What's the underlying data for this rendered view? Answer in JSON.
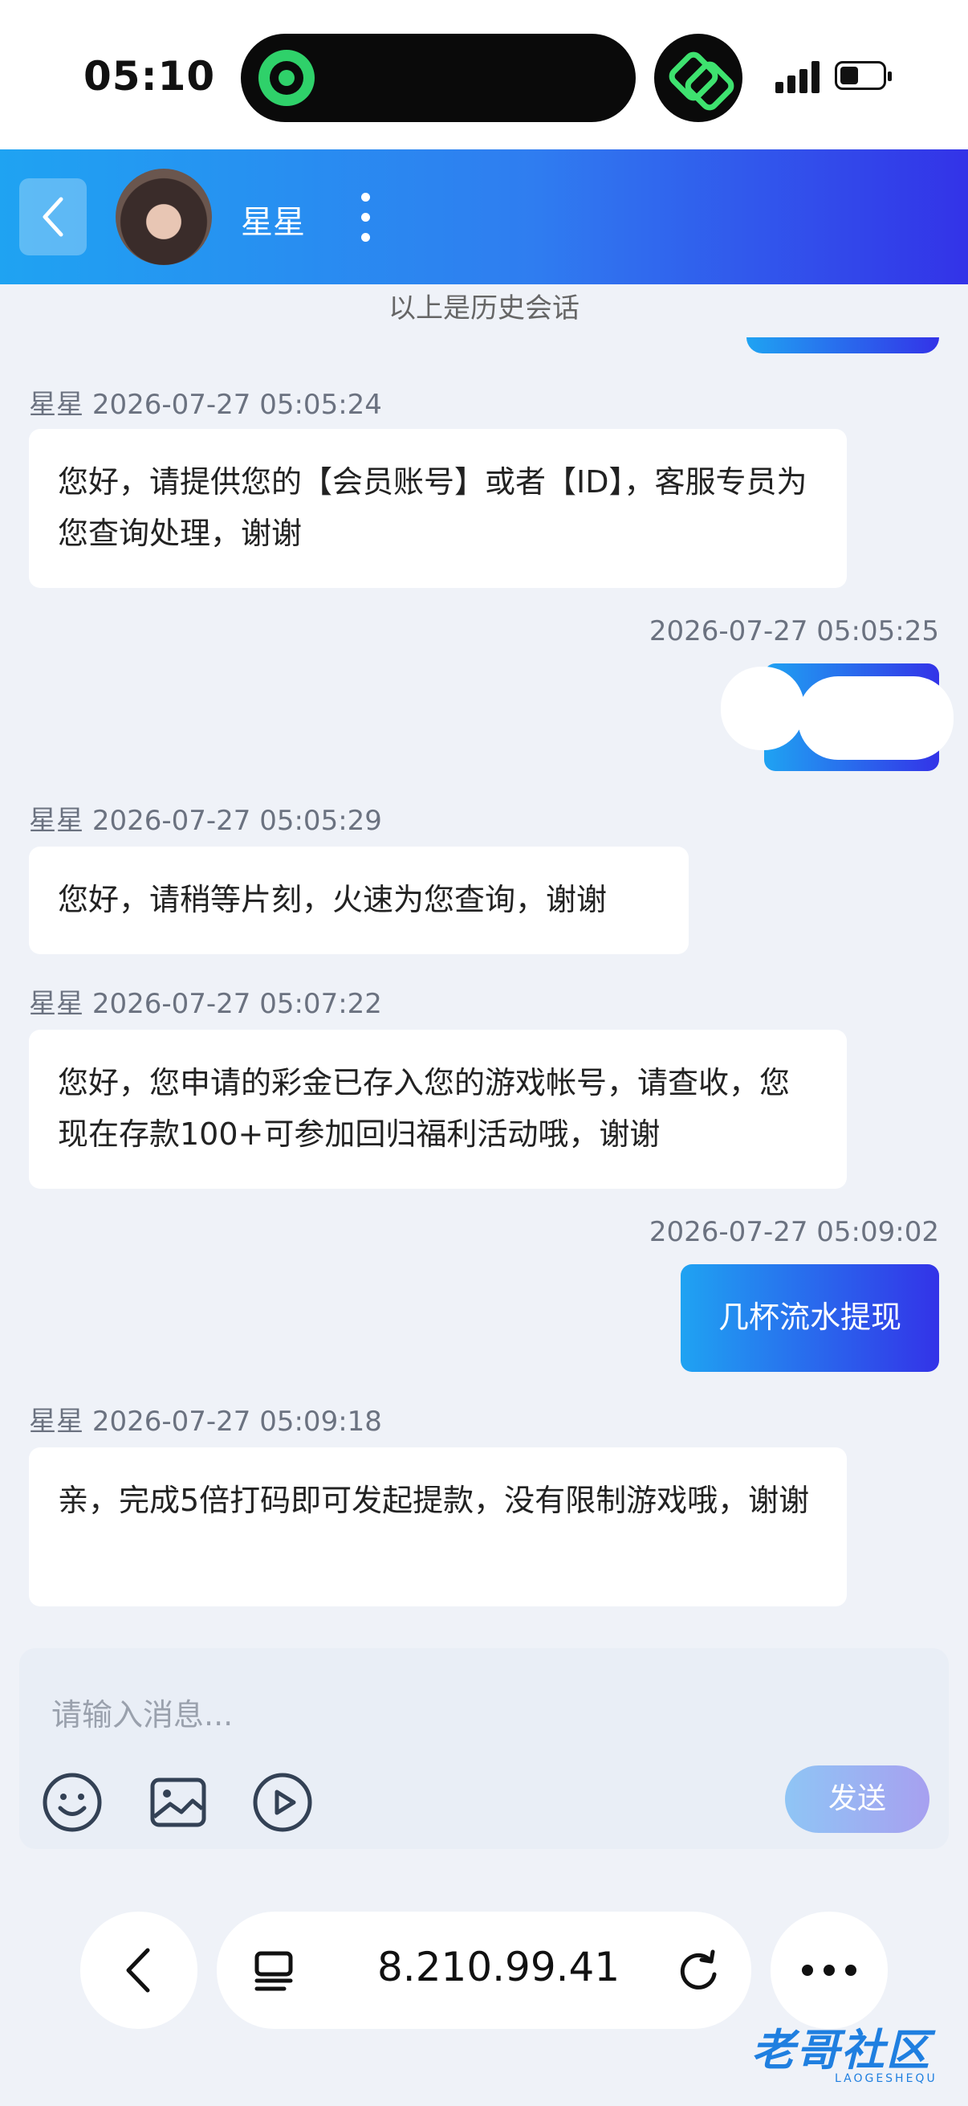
{
  "status_bar": {
    "time": "05:10"
  },
  "header": {
    "contact_name": "星星"
  },
  "history_note": "以上是历史会话",
  "messages": [
    {
      "sender": "星星",
      "timestamp": "2026-07-27 05:05:24",
      "text": "您好，请提供您的【会员账号】或者【ID】，客服专员为您查询处理，谢谢"
    },
    {
      "sender": "",
      "timestamp": "2026-07-27 05:05:25",
      "text": ""
    },
    {
      "sender": "星星",
      "timestamp": "2026-07-27 05:05:29",
      "text": "您好，请稍等片刻，火速为您查询，谢谢"
    },
    {
      "sender": "星星",
      "timestamp": "2026-07-27 05:07:22",
      "text": "您好，您申请的彩金已存入您的游戏帐号，请查收，您现在存款100+可参加回归福利活动哦，谢谢"
    },
    {
      "sender": "",
      "timestamp": "2026-07-27 05:09:02",
      "text": "几杯流水提现"
    },
    {
      "sender": "星星",
      "timestamp": "2026-07-27 05:09:18",
      "text": "亲，完成5倍打码即可发起提款，没有限制游戏哦，谢谢"
    }
  ],
  "composer": {
    "placeholder": "请输入消息...",
    "send_label": "发送",
    "tools": [
      "emoji-icon",
      "image-icon",
      "video-icon"
    ]
  },
  "browser": {
    "url": "8.210.99.41"
  },
  "watermark": {
    "text": "老哥社区",
    "sub": "LAOGESHEQU"
  },
  "colors": {
    "accent_start": "#1fa3f2",
    "accent_end": "#3333e8",
    "background": "#eff2f8"
  }
}
